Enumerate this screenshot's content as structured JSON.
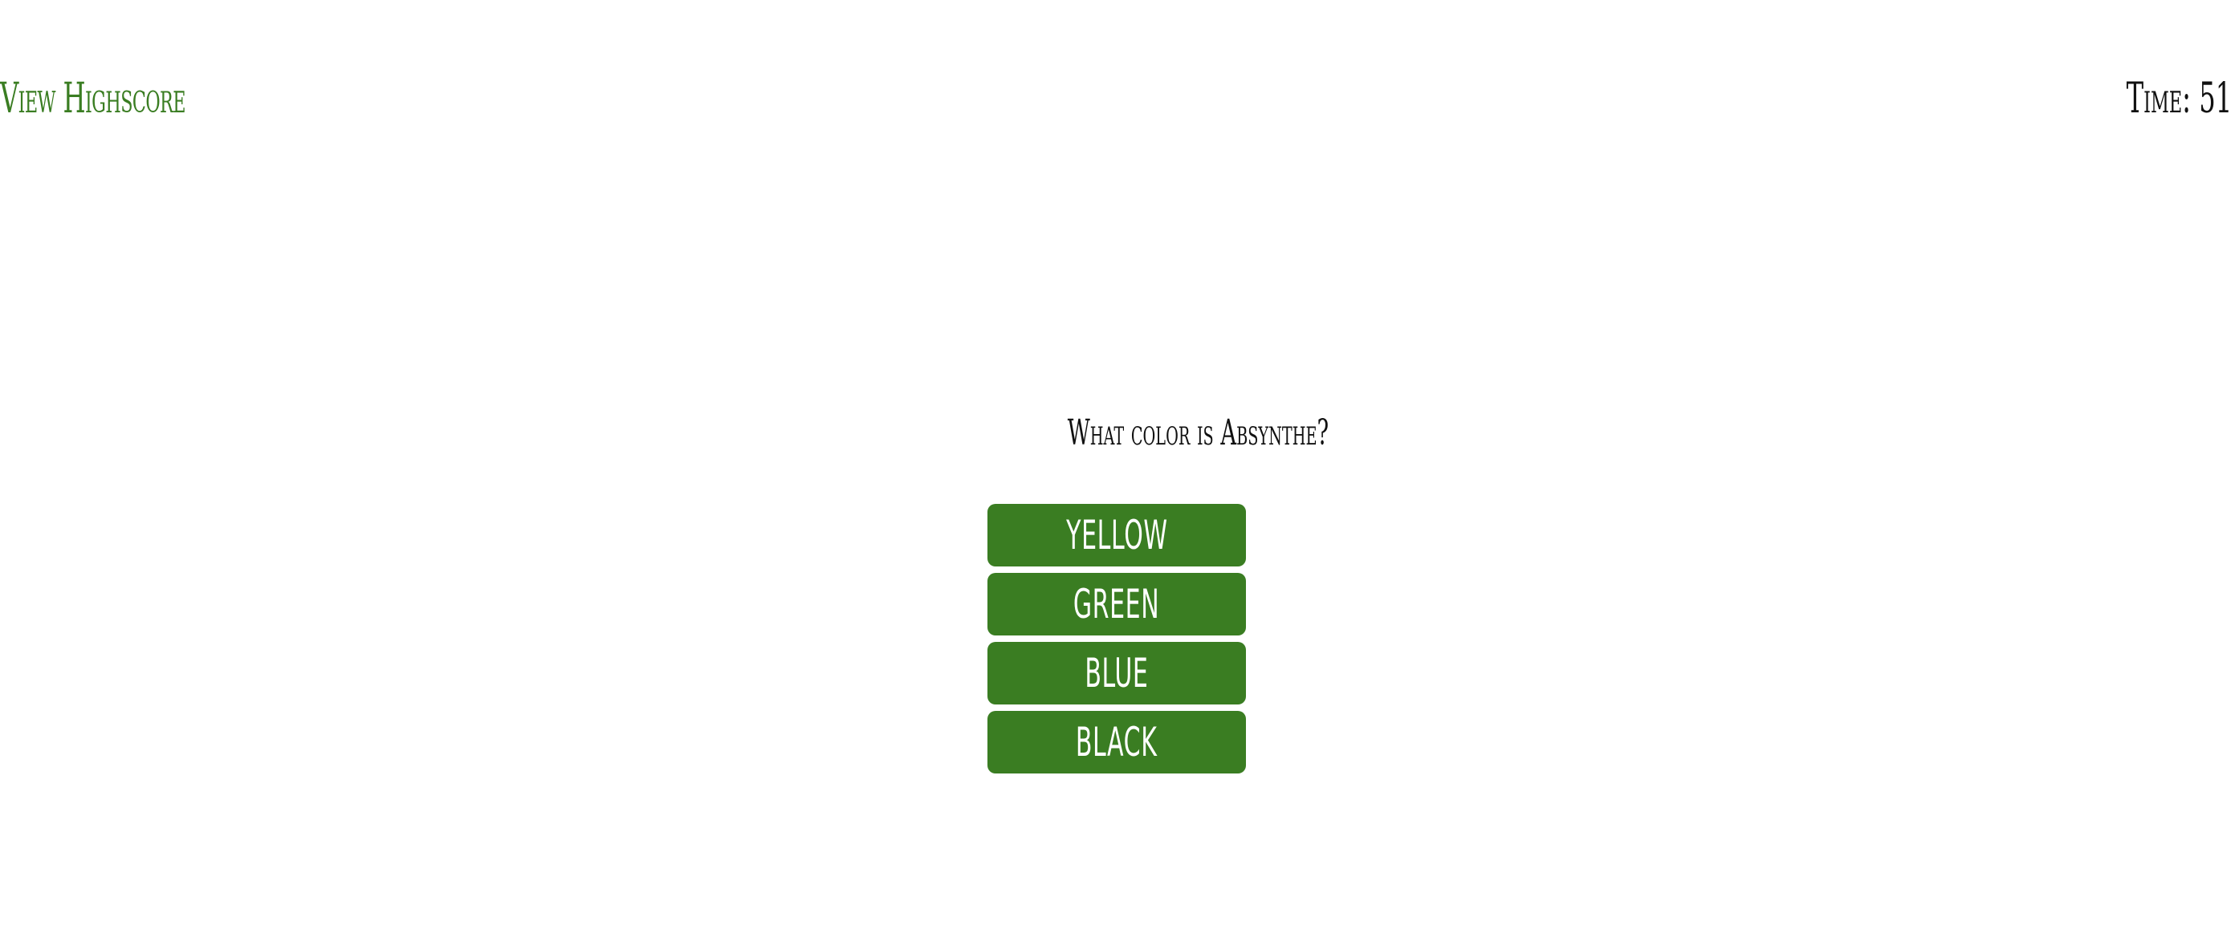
{
  "header": {
    "highscore_label": "View Highscore",
    "timer_text": "Time: 51"
  },
  "quiz": {
    "question": "What color is Absynthe?",
    "answers": [
      {
        "label": "YELLOW"
      },
      {
        "label": "GREEN"
      },
      {
        "label": "BLUE"
      },
      {
        "label": "BLACK"
      }
    ]
  },
  "colors": {
    "accent": "#3a7d22",
    "text": "#111111",
    "background": "#ffffff"
  }
}
